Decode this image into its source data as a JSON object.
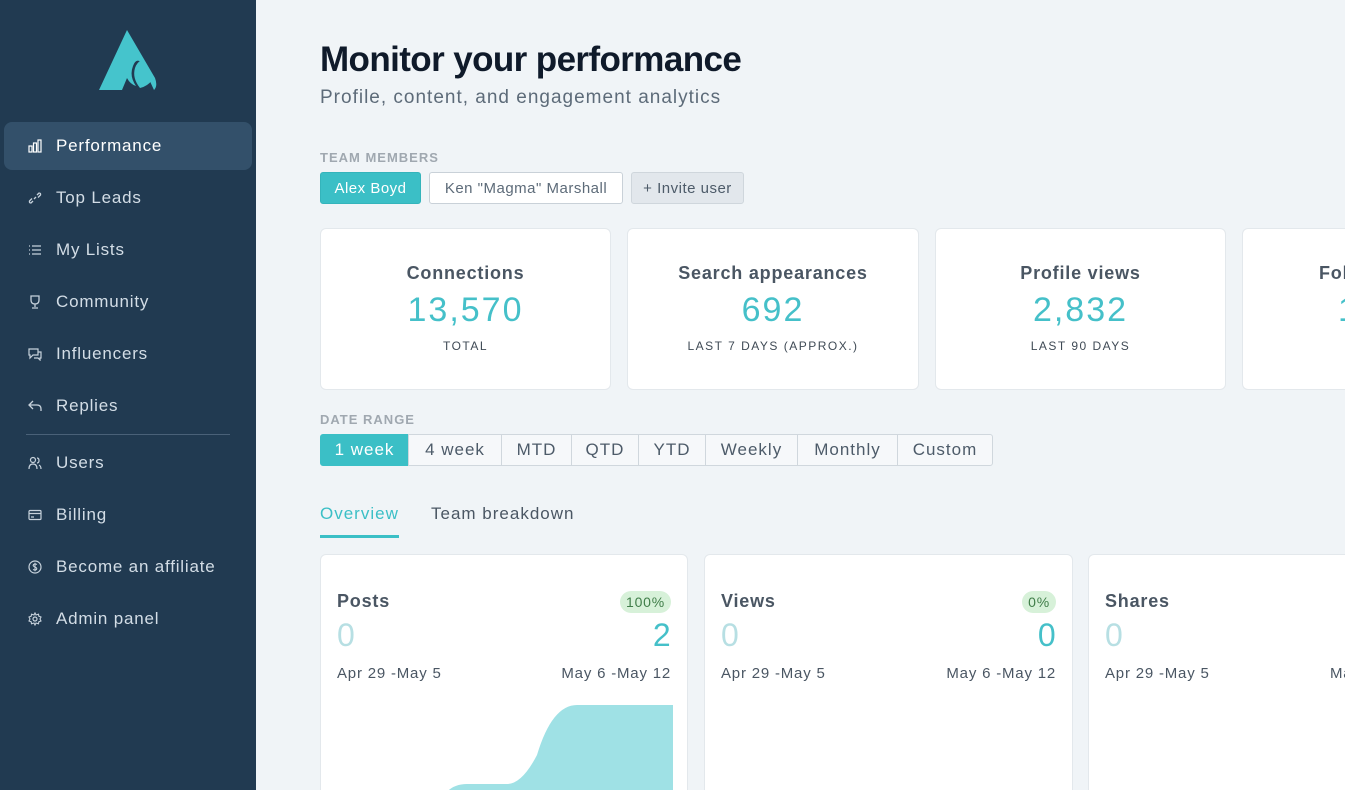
{
  "sidebar": {
    "items": [
      {
        "label": "Performance",
        "icon": "bar-chart-icon",
        "active": true
      },
      {
        "label": "Top Leads",
        "icon": "link-icon"
      },
      {
        "label": "My Lists",
        "icon": "list-icon"
      },
      {
        "label": "Community",
        "icon": "trophy-icon"
      },
      {
        "label": "Influencers",
        "icon": "chat-icon"
      },
      {
        "label": "Replies",
        "icon": "reply-icon"
      },
      {
        "label": "Users",
        "icon": "users-icon"
      },
      {
        "label": "Billing",
        "icon": "credit-card-icon"
      },
      {
        "label": "Become an affiliate",
        "icon": "dollar-icon"
      },
      {
        "label": "Admin panel",
        "icon": "gear-icon"
      }
    ]
  },
  "header": {
    "title": "Monitor your performance",
    "subtitle": "Profile, content, and engagement analytics"
  },
  "team": {
    "label": "TEAM MEMBERS",
    "members": [
      "Alex Boyd",
      "Ken \"Magma\" Marshall"
    ],
    "invite_label": "+ Invite user"
  },
  "stats": [
    {
      "title": "Connections",
      "value": "13,570",
      "sub": "TOTAL"
    },
    {
      "title": "Search appearances",
      "value": "692",
      "sub": "LAST 7 DAYS (APPROX.)"
    },
    {
      "title": "Profile views",
      "value": "2,832",
      "sub": "LAST 90 DAYS"
    },
    {
      "title": "Fol",
      "value": "1",
      "sub": ""
    }
  ],
  "date_range": {
    "label": "DATE RANGE",
    "options": [
      "1 week",
      "4 week",
      "MTD",
      "QTD",
      "YTD",
      "Weekly",
      "Monthly",
      "Custom"
    ],
    "selected": "1 week"
  },
  "tabs": [
    "Overview",
    "Team breakdown"
  ],
  "metrics": [
    {
      "title": "Posts",
      "badge": "100%",
      "prev": "0",
      "cur": "2",
      "prev_range": "Apr 29 -May 5",
      "cur_range": "May 6 -May 12"
    },
    {
      "title": "Views",
      "badge": "0%",
      "prev": "0",
      "cur": "0",
      "prev_range": "Apr 29 -May 5",
      "cur_range": "May 6 -May 12"
    },
    {
      "title": "Shares",
      "badge": "",
      "prev": "0",
      "cur": "",
      "prev_range": "Apr 29 -May 5",
      "cur_range": "Ma"
    }
  ],
  "colors": {
    "accent": "#3bbfc6",
    "sidebar": "#213a51",
    "sidebar_active": "#33506a",
    "badge_bg": "#d7f1d9"
  }
}
